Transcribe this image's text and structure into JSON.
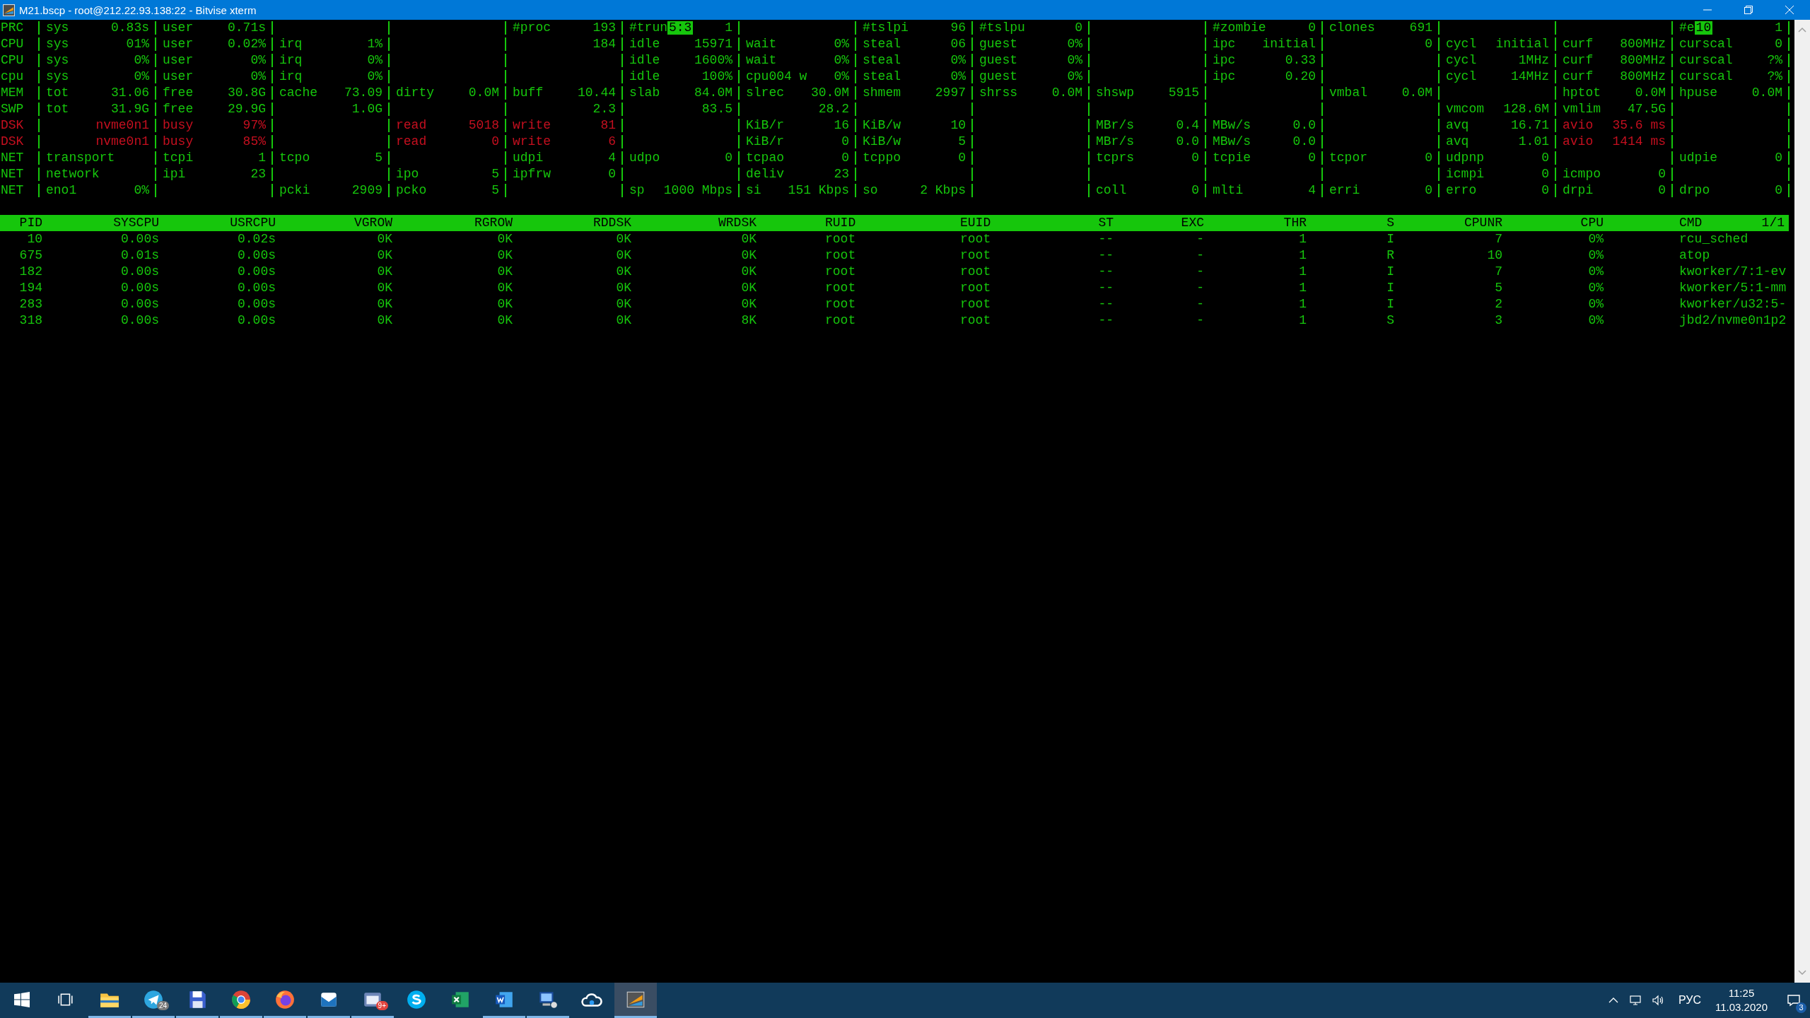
{
  "window": {
    "title": "M21.bscp - root@212.22.93.138:22 - Bitvise xterm"
  },
  "stats": [
    {
      "label": "PRC",
      "alert": false,
      "fields": [
        {
          "kind": "metric",
          "name": "sys",
          "value": "0.83s",
          "alert": false
        },
        {
          "kind": "metric",
          "name": "user",
          "value": "0.71s",
          "alert": false
        },
        {
          "kind": "blank"
        },
        {
          "kind": "blank"
        },
        {
          "kind": "metric",
          "name": "#proc",
          "value": "193",
          "alert": false
        },
        {
          "kind": "metric",
          "name": "#trun",
          "highlight": "5:3",
          "value": "1",
          "alert": false
        },
        {
          "kind": "blank"
        },
        {
          "kind": "metric",
          "name": "#tslpi",
          "value": "96",
          "alert": false
        },
        {
          "kind": "metric",
          "name": "#tslpu",
          "value": "0",
          "alert": false
        },
        {
          "kind": "blank"
        },
        {
          "kind": "metric",
          "name": "#zombie",
          "value": "0",
          "alert": false
        },
        {
          "kind": "metric",
          "name": "clones",
          "value": "691",
          "alert": false
        },
        {
          "kind": "blank"
        },
        {
          "kind": "blank"
        },
        {
          "kind": "metric",
          "name": "#e",
          "highlight": "10",
          "value": "1",
          "alert": false
        }
      ]
    },
    {
      "label": "CPU",
      "alert": false,
      "fields": [
        {
          "kind": "metric",
          "name": "sys",
          "value": "01%",
          "alert": false
        },
        {
          "kind": "metric",
          "name": "user",
          "value": "0.02%",
          "alert": false
        },
        {
          "kind": "metric",
          "name": "irq",
          "value": "1%",
          "alert": false
        },
        {
          "kind": "blank"
        },
        {
          "kind": "metric",
          "value": "184",
          "alert": false
        },
        {
          "kind": "metric",
          "name": "idle",
          "value": "15971",
          "alert": false
        },
        {
          "kind": "metric",
          "name": "wait",
          "value": "0%",
          "alert": false
        },
        {
          "kind": "metric",
          "name": "steal",
          "value": "06",
          "alert": false
        },
        {
          "kind": "metric",
          "name": "guest",
          "value": "0%",
          "alert": false
        },
        {
          "kind": "blank"
        },
        {
          "kind": "metric",
          "name": "ipc",
          "value": "initial",
          "alert": false
        },
        {
          "kind": "metric",
          "value": "0",
          "alert": false
        },
        {
          "kind": "metric",
          "name": "cycl",
          "value": "initial",
          "alert": false
        },
        {
          "kind": "metric",
          "name": "curf",
          "value": "800MHz",
          "alert": false
        },
        {
          "kind": "metric",
          "name": "curscal",
          "value": "0",
          "alert": false
        }
      ]
    },
    {
      "label": "CPU",
      "alert": false,
      "fields": [
        {
          "kind": "metric",
          "name": "sys",
          "value": "0%",
          "alert": false
        },
        {
          "kind": "metric",
          "name": "user",
          "value": "0%",
          "alert": false
        },
        {
          "kind": "metric",
          "name": "irq",
          "value": "0%",
          "alert": false
        },
        {
          "kind": "blank"
        },
        {
          "kind": "blank"
        },
        {
          "kind": "metric",
          "name": "idle",
          "value": "1600%",
          "alert": false
        },
        {
          "kind": "metric",
          "name": "wait",
          "value": "0%",
          "alert": false
        },
        {
          "kind": "metric",
          "name": "steal",
          "value": "0%",
          "alert": false
        },
        {
          "kind": "metric",
          "name": "guest",
          "value": "0%",
          "alert": false
        },
        {
          "kind": "blank"
        },
        {
          "kind": "metric",
          "name": "ipc",
          "value": "0.33",
          "alert": false
        },
        {
          "kind": "blank"
        },
        {
          "kind": "metric",
          "name": "cycl",
          "value": "1MHz",
          "alert": false
        },
        {
          "kind": "metric",
          "name": "curf",
          "value": "800MHz",
          "alert": false
        },
        {
          "kind": "metric",
          "name": "curscal",
          "value": "?%",
          "alert": false
        }
      ]
    },
    {
      "label": "cpu",
      "alert": false,
      "fields": [
        {
          "kind": "metric",
          "name": "sys",
          "value": "0%",
          "alert": false
        },
        {
          "kind": "metric",
          "name": "user",
          "value": "0%",
          "alert": false
        },
        {
          "kind": "metric",
          "name": "irq",
          "value": "0%",
          "alert": false
        },
        {
          "kind": "blank"
        },
        {
          "kind": "blank"
        },
        {
          "kind": "metric",
          "name": "idle",
          "value": "100%",
          "alert": false
        },
        {
          "kind": "metric",
          "name": "cpu004 w",
          "value": "0%",
          "alert": false
        },
        {
          "kind": "metric",
          "name": "steal",
          "value": "0%",
          "alert": false
        },
        {
          "kind": "metric",
          "name": "guest",
          "value": "0%",
          "alert": false
        },
        {
          "kind": "blank"
        },
        {
          "kind": "metric",
          "name": "ipc",
          "value": "0.20",
          "alert": false
        },
        {
          "kind": "blank"
        },
        {
          "kind": "metric",
          "name": "cycl",
          "value": "14MHz",
          "alert": false
        },
        {
          "kind": "metric",
          "name": "curf",
          "value": "800MHz",
          "alert": false
        },
        {
          "kind": "metric",
          "name": "curscal",
          "value": "?%",
          "alert": false
        }
      ]
    },
    {
      "label": "MEM",
      "alert": false,
      "fields": [
        {
          "kind": "metric",
          "name": "tot",
          "value": "31.06",
          "alert": false
        },
        {
          "kind": "metric",
          "name": "free",
          "value": "30.8G",
          "alert": false
        },
        {
          "kind": "metric",
          "name": "cache",
          "value": "73.09",
          "alert": false
        },
        {
          "kind": "metric",
          "name": "dirty",
          "value": "0.0M",
          "alert": false
        },
        {
          "kind": "metric",
          "name": "buff",
          "value": "10.44",
          "alert": false
        },
        {
          "kind": "metric",
          "name": "slab",
          "value": "84.0M",
          "alert": false
        },
        {
          "kind": "metric",
          "name": "slrec",
          "value": "30.0M",
          "alert": false
        },
        {
          "kind": "metric",
          "name": "shmem",
          "value": "2997",
          "alert": false
        },
        {
          "kind": "metric",
          "name": "shrss",
          "value": "0.0M",
          "alert": false
        },
        {
          "kind": "metric",
          "name": "shswp",
          "value": "5915",
          "alert": false
        },
        {
          "kind": "blank"
        },
        {
          "kind": "metric",
          "name": "vmbal",
          "value": "0.0M",
          "alert": false
        },
        {
          "kind": "blank"
        },
        {
          "kind": "metric",
          "name": "hptot",
          "value": "0.0M",
          "alert": false
        },
        {
          "kind": "metric",
          "name": "hpuse",
          "value": "0.0M",
          "alert": false
        }
      ]
    },
    {
      "label": "SWP",
      "alert": false,
      "fields": [
        {
          "kind": "metric",
          "name": "tot",
          "value": "31.9G",
          "alert": false
        },
        {
          "kind": "metric",
          "name": "free",
          "value": "29.9G",
          "alert": false
        },
        {
          "kind": "metric",
          "value": "1.0G",
          "alert": false
        },
        {
          "kind": "blank"
        },
        {
          "kind": "metric",
          "value": "2.3",
          "alert": false
        },
        {
          "kind": "metric",
          "value": "83.5",
          "alert": false
        },
        {
          "kind": "metric",
          "value": "28.2",
          "alert": false
        },
        {
          "kind": "blank"
        },
        {
          "kind": "blank"
        },
        {
          "kind": "blank"
        },
        {
          "kind": "blank"
        },
        {
          "kind": "blank"
        },
        {
          "kind": "metric",
          "name": "vmcom",
          "value": "128.6M",
          "alert": false
        },
        {
          "kind": "metric",
          "name": "vmlim",
          "value": "47.5G",
          "alert": false
        },
        {
          "kind": "blank"
        }
      ]
    },
    {
      "label": "DSK",
      "alert": true,
      "fields": [
        {
          "kind": "metric",
          "value": "nvme0n1",
          "alert": true
        },
        {
          "kind": "metric",
          "name": "busy",
          "value": "97%",
          "alert": true
        },
        {
          "kind": "blank"
        },
        {
          "kind": "metric",
          "name": "read",
          "value": "5018",
          "alert": true
        },
        {
          "kind": "metric",
          "name": "write",
          "value": "81",
          "alert": true
        },
        {
          "kind": "blank"
        },
        {
          "kind": "metric",
          "name": "KiB/r",
          "value": "16",
          "alert": false
        },
        {
          "kind": "metric",
          "name": "KiB/w",
          "value": "10",
          "alert": false
        },
        {
          "kind": "blank"
        },
        {
          "kind": "metric",
          "name": "MBr/s",
          "value": "0.4",
          "alert": false
        },
        {
          "kind": "metric",
          "name": "MBw/s",
          "value": "0.0",
          "alert": false
        },
        {
          "kind": "blank"
        },
        {
          "kind": "metric",
          "name": "avq",
          "value": "16.71",
          "alert": false
        },
        {
          "kind": "metric",
          "name": "avio",
          "value": "35.6 ms",
          "alert": true
        },
        {
          "kind": "blank"
        }
      ]
    },
    {
      "label": "DSK",
      "alert": true,
      "fields": [
        {
          "kind": "metric",
          "value": "nvme0n1",
          "alert": true
        },
        {
          "kind": "metric",
          "name": "busy",
          "value": "85%",
          "alert": true
        },
        {
          "kind": "blank"
        },
        {
          "kind": "metric",
          "name": "read",
          "value": "0",
          "alert": true
        },
        {
          "kind": "metric",
          "name": "write",
          "value": "6",
          "alert": true
        },
        {
          "kind": "blank"
        },
        {
          "kind": "metric",
          "name": "KiB/r",
          "value": "0",
          "alert": false
        },
        {
          "kind": "metric",
          "name": "KiB/w",
          "value": "5",
          "alert": false
        },
        {
          "kind": "blank"
        },
        {
          "kind": "metric",
          "name": "MBr/s",
          "value": "0.0",
          "alert": false
        },
        {
          "kind": "metric",
          "name": "MBw/s",
          "value": "0.0",
          "alert": false
        },
        {
          "kind": "blank"
        },
        {
          "kind": "metric",
          "name": "avq",
          "value": "1.01",
          "alert": false
        },
        {
          "kind": "metric",
          "name": "avio",
          "value": "1414 ms",
          "alert": true
        },
        {
          "kind": "blank"
        }
      ]
    },
    {
      "label": "NET",
      "alert": false,
      "fields": [
        {
          "kind": "metric",
          "name": "transport",
          "alert": false
        },
        {
          "kind": "metric",
          "name": "tcpi",
          "value": "1",
          "alert": false
        },
        {
          "kind": "metric",
          "name": "tcpo",
          "value": "5",
          "alert": false
        },
        {
          "kind": "blank"
        },
        {
          "kind": "metric",
          "name": "udpi",
          "value": "4",
          "alert": false
        },
        {
          "kind": "metric",
          "name": "udpo",
          "value": "0",
          "alert": false
        },
        {
          "kind": "metric",
          "name": "tcpao",
          "value": "0",
          "alert": false
        },
        {
          "kind": "metric",
          "name": "tcppo",
          "value": "0",
          "alert": false
        },
        {
          "kind": "blank"
        },
        {
          "kind": "metric",
          "name": "tcprs",
          "value": "0",
          "alert": false
        },
        {
          "kind": "metric",
          "name": "tcpie",
          "value": "0",
          "alert": false
        },
        {
          "kind": "metric",
          "name": "tcpor",
          "value": "0",
          "alert": false
        },
        {
          "kind": "metric",
          "name": "udpnp",
          "value": "0",
          "alert": false
        },
        {
          "kind": "blank"
        },
        {
          "kind": "metric",
          "name": "udpie",
          "value": "0",
          "alert": false
        }
      ]
    },
    {
      "label": "NET",
      "alert": false,
      "fields": [
        {
          "kind": "metric",
          "name": "network",
          "alert": false
        },
        {
          "kind": "metric",
          "name": "ipi",
          "value": "23",
          "alert": false
        },
        {
          "kind": "blank"
        },
        {
          "kind": "metric",
          "name": "ipo",
          "value": "5",
          "alert": false
        },
        {
          "kind": "metric",
          "name": "ipfrw",
          "value": "0",
          "alert": false
        },
        {
          "kind": "blank"
        },
        {
          "kind": "metric",
          "name": "deliv",
          "value": "23",
          "alert": false
        },
        {
          "kind": "blank"
        },
        {
          "kind": "blank"
        },
        {
          "kind": "blank"
        },
        {
          "kind": "blank"
        },
        {
          "kind": "blank"
        },
        {
          "kind": "metric",
          "name": "icmpi",
          "value": "0",
          "alert": false
        },
        {
          "kind": "metric",
          "name": "icmpo",
          "value": "0",
          "alert": false
        },
        {
          "kind": "blank"
        }
      ]
    },
    {
      "label": "NET",
      "alert": false,
      "fields": [
        {
          "kind": "metric",
          "name": "eno1",
          "value": "0%",
          "alert": false
        },
        {
          "kind": "blank"
        },
        {
          "kind": "metric",
          "name": "pcki",
          "value": "2909",
          "alert": false
        },
        {
          "kind": "metric",
          "name": "pcko",
          "value": "5",
          "alert": false
        },
        {
          "kind": "blank"
        },
        {
          "kind": "metric",
          "name": "sp",
          "value": "1000 Mbps",
          "alert": false
        },
        {
          "kind": "metric",
          "name": "si",
          "value": "151 Kbps",
          "alert": false
        },
        {
          "kind": "metric",
          "name": "so",
          "value": "2 Kbps",
          "alert": false
        },
        {
          "kind": "blank"
        },
        {
          "kind": "metric",
          "name": "coll",
          "value": "0",
          "alert": false
        },
        {
          "kind": "metric",
          "name": "mlti",
          "value": "4",
          "alert": false
        },
        {
          "kind": "metric",
          "name": "erri",
          "value": "0",
          "alert": false
        },
        {
          "kind": "metric",
          "name": "erro",
          "value": "0",
          "alert": false
        },
        {
          "kind": "metric",
          "name": "drpi",
          "value": "0",
          "alert": false
        },
        {
          "kind": "metric",
          "name": "drpo",
          "value": "0",
          "alert": false
        }
      ]
    }
  ],
  "processes": {
    "columns": [
      "PID",
      "SYSCPU",
      "USRCPU",
      "VGROW",
      "RGROW",
      "RDDSK",
      "WRDSK",
      "RUID",
      "EUID",
      "ST",
      "EXC",
      "THR",
      "S",
      "CPUNR",
      "CPU",
      "CMD"
    ],
    "page": "1/1",
    "rows": [
      [
        "10",
        "0.00s",
        "0.02s",
        "0K",
        "0K",
        "0K",
        "0K",
        "root",
        "root",
        "--",
        "-",
        "1",
        "I",
        "7",
        "0%",
        "rcu_sched"
      ],
      [
        "675",
        "0.01s",
        "0.00s",
        "0K",
        "0K",
        "0K",
        "0K",
        "root",
        "root",
        "--",
        "-",
        "1",
        "R",
        "10",
        "0%",
        "atop"
      ],
      [
        "182",
        "0.00s",
        "0.00s",
        "0K",
        "0K",
        "0K",
        "0K",
        "root",
        "root",
        "--",
        "-",
        "1",
        "I",
        "7",
        "0%",
        "kworker/7:1-ev"
      ],
      [
        "194",
        "0.00s",
        "0.00s",
        "0K",
        "0K",
        "0K",
        "0K",
        "root",
        "root",
        "--",
        "-",
        "1",
        "I",
        "5",
        "0%",
        "kworker/5:1-mm"
      ],
      [
        "283",
        "0.00s",
        "0.00s",
        "0K",
        "0K",
        "0K",
        "0K",
        "root",
        "root",
        "--",
        "-",
        "1",
        "I",
        "2",
        "0%",
        "kworker/u32:5-"
      ],
      [
        "318",
        "0.00s",
        "0.00s",
        "0K",
        "0K",
        "0K",
        "8K",
        "root",
        "root",
        "--",
        "-",
        "1",
        "S",
        "3",
        "0%",
        "jbd2/nvme0n1p2"
      ]
    ]
  },
  "taskbar": {
    "apps": [
      {
        "kind": "folder",
        "running": true,
        "selected": false
      },
      {
        "kind": "messenger",
        "running": true,
        "selected": false,
        "badge": {
          "text": "24",
          "color": "#7a7a7a"
        }
      },
      {
        "kind": "floppy",
        "running": true,
        "selected": false
      },
      {
        "kind": "browser",
        "running": true,
        "selected": false
      },
      {
        "kind": "fox",
        "running": true,
        "selected": false
      },
      {
        "kind": "mail",
        "running": true,
        "selected": false
      },
      {
        "kind": "window",
        "running": true,
        "selected": false,
        "badge": {
          "text": "9+",
          "color": "#e0443e"
        }
      },
      {
        "kind": "chat",
        "running": false,
        "selected": false
      },
      {
        "kind": "sheet",
        "running": false,
        "selected": false
      },
      {
        "kind": "doc",
        "running": true,
        "selected": false
      },
      {
        "kind": "remote",
        "running": true,
        "selected": false
      },
      {
        "kind": "cloud",
        "running": false,
        "selected": false
      },
      {
        "kind": "terminal",
        "running": true,
        "selected": true
      }
    ],
    "tray": {
      "language": "РУС",
      "time": "11:25",
      "date": "11.03.2020",
      "notifications": "3"
    }
  }
}
